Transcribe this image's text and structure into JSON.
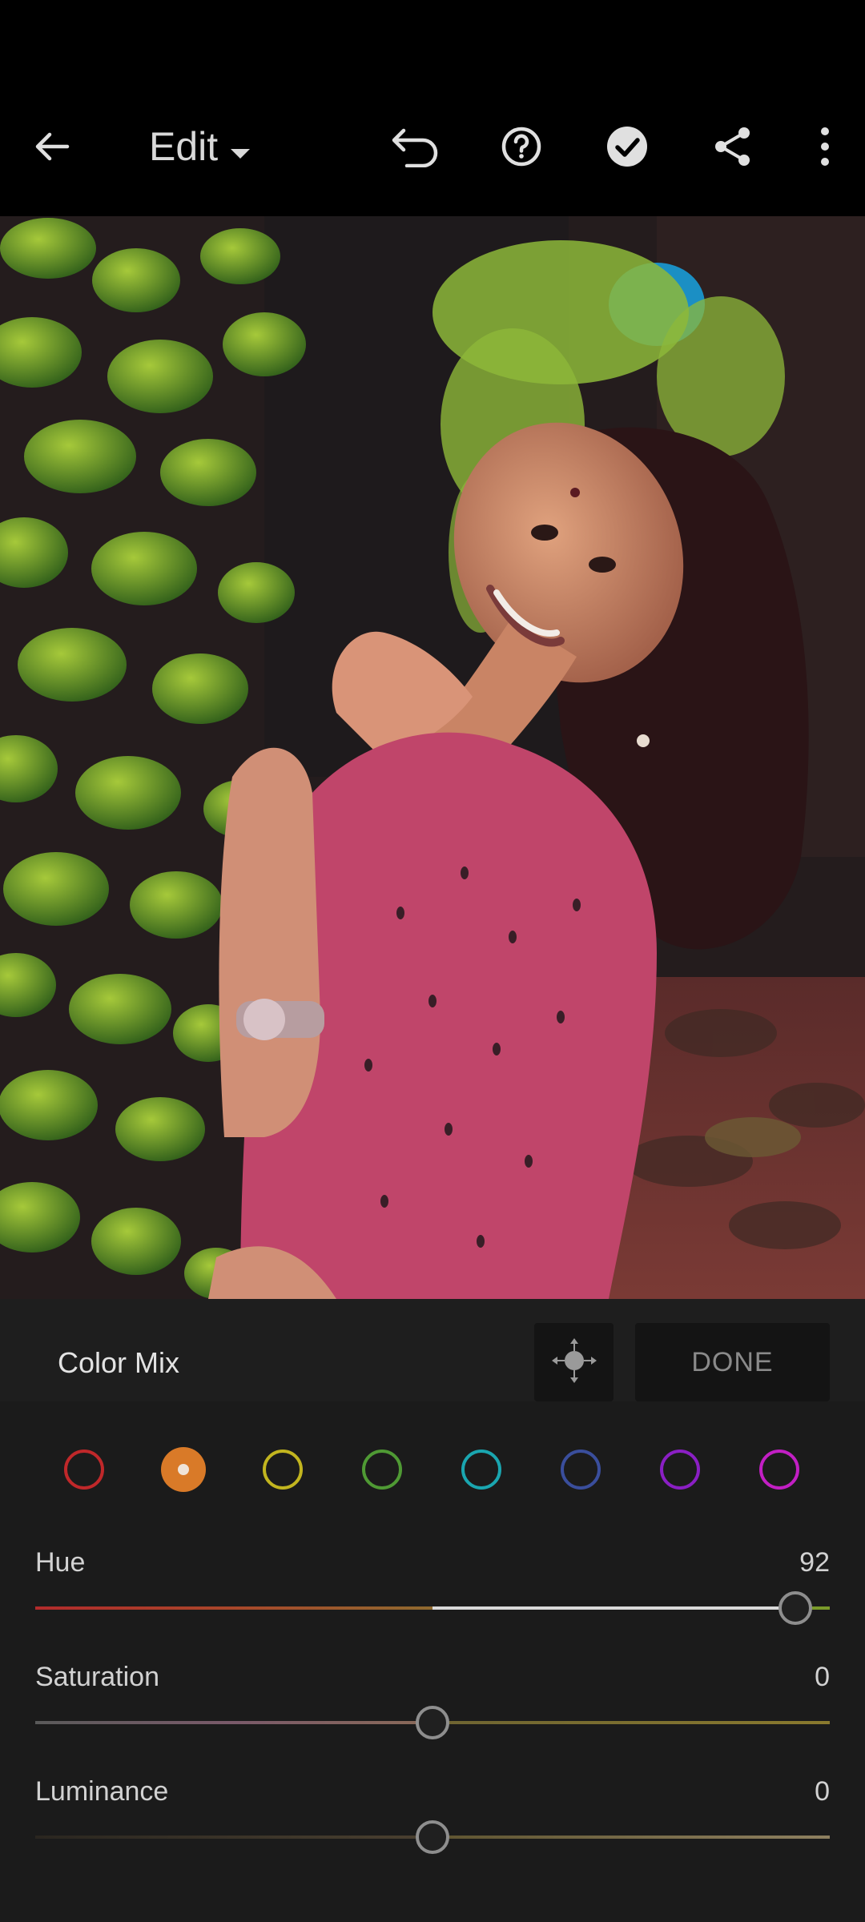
{
  "header": {
    "title": "Edit",
    "icons": [
      "back-arrow-icon",
      "dropdown-caret-icon",
      "undo-icon",
      "help-icon",
      "checkmark-icon",
      "share-icon",
      "more-vertical-icon"
    ]
  },
  "photo": {
    "description_icon": "portrait-photo"
  },
  "color_mix": {
    "title": "Color Mix",
    "done_label": "DONE",
    "target_icon": "targeted-adjustment-icon",
    "swatches": [
      {
        "name": "red",
        "color": "#c0282a",
        "selected": false
      },
      {
        "name": "orange",
        "color": "#d97a28",
        "selected": true
      },
      {
        "name": "yellow",
        "color": "#c2b51f",
        "selected": false
      },
      {
        "name": "green",
        "color": "#4f9a34",
        "selected": false
      },
      {
        "name": "aqua",
        "color": "#1aa6b0",
        "selected": false
      },
      {
        "name": "blue",
        "color": "#3a4e9c",
        "selected": false
      },
      {
        "name": "purple",
        "color": "#8a1fc4",
        "selected": false
      },
      {
        "name": "magenta",
        "color": "#c21fc4",
        "selected": false
      }
    ],
    "sliders": [
      {
        "label": "Hue",
        "value": "92",
        "position": 0.964
      },
      {
        "label": "Saturation",
        "value": "0",
        "position": 0.5
      },
      {
        "label": "Luminance",
        "value": "0",
        "position": 0.5
      }
    ]
  },
  "colors": {
    "background": "#1b1b1b",
    "topbar": "#000000",
    "accent_orange": "#d97a28"
  }
}
